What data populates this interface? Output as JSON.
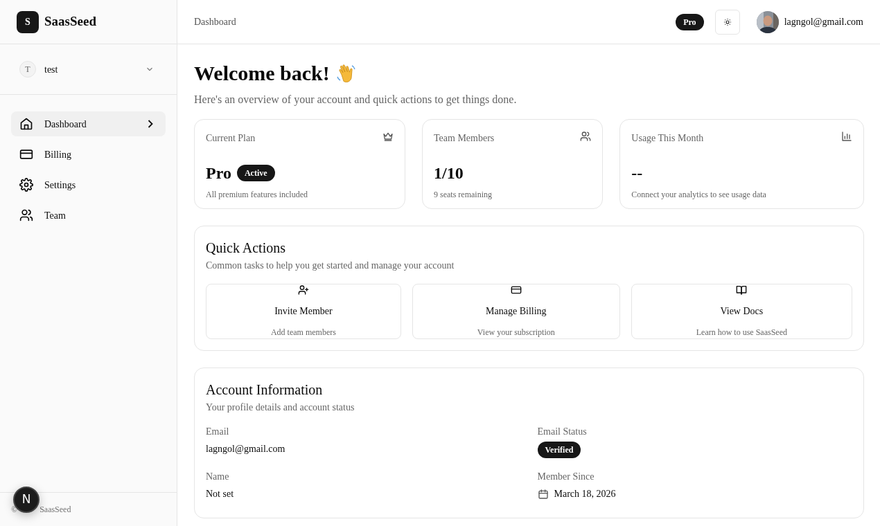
{
  "brand": {
    "logo_letter": "S",
    "name": "SaasSeed"
  },
  "workspace": {
    "initial": "T",
    "name": "test"
  },
  "nav": [
    {
      "label": "Dashboard",
      "selected": true
    },
    {
      "label": "Billing",
      "selected": false
    },
    {
      "label": "Settings",
      "selected": false
    },
    {
      "label": "Team",
      "selected": false
    }
  ],
  "footer": {
    "copyright_start": "©",
    "copyright_end": "SaasSeed"
  },
  "dev_indicator": {
    "letter": "N"
  },
  "header": {
    "breadcrumb": "Dashboard",
    "plan_badge": "Pro",
    "user_email": "lagngol@gmail.com"
  },
  "welcome": {
    "title": "Welcome back!",
    "subtitle": "Here's an overview of your account and quick actions to get things done."
  },
  "stats": [
    {
      "title": "Current Plan",
      "value": "Pro",
      "badge": "Active",
      "note": "All premium features included"
    },
    {
      "title": "Team Members",
      "value": "1/10",
      "note": "9 seats remaining"
    },
    {
      "title": "Usage This Month",
      "value": "--",
      "note": "Connect your analytics to see usage data"
    }
  ],
  "quick_actions": {
    "title": "Quick Actions",
    "subtitle": "Common tasks to help you get started and manage your account",
    "actions": [
      {
        "label": "Invite Member",
        "description": "Add team members"
      },
      {
        "label": "Manage Billing",
        "description": "View your subscription"
      },
      {
        "label": "View Docs",
        "description": "Learn how to use SaasSeed"
      }
    ]
  },
  "account": {
    "title": "Account Information",
    "subtitle": "Your profile details and account status",
    "fields": [
      {
        "label": "Email",
        "value": "lagngol@gmail.com",
        "kind": "text"
      },
      {
        "label": "Email Status",
        "value": "Verified",
        "kind": "badge"
      },
      {
        "label": "Name",
        "value": "Not set",
        "kind": "text"
      },
      {
        "label": "Member Since",
        "value": "March 18, 2026",
        "kind": "date"
      }
    ]
  }
}
